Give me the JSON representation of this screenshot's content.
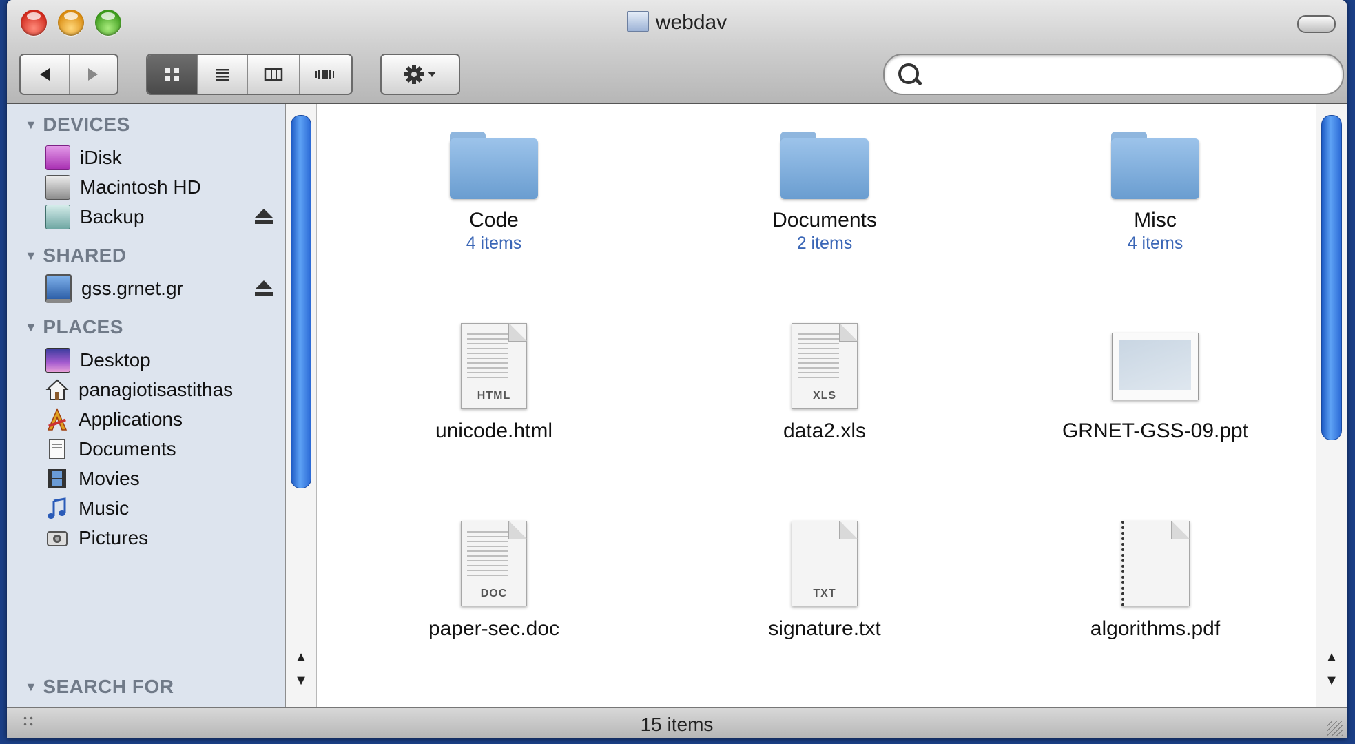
{
  "window": {
    "title": "webdav"
  },
  "toolbar": {
    "back_icon": "back-arrow-icon",
    "forward_icon": "forward-arrow-icon",
    "view_modes": [
      "icon-view",
      "list-view",
      "column-view",
      "coverflow-view"
    ],
    "action_icon": "gear-icon",
    "search_placeholder": ""
  },
  "sidebar": {
    "sections": [
      {
        "header": "DEVICES",
        "items": [
          {
            "label": "iDisk",
            "icon": "idisk-icon"
          },
          {
            "label": "Macintosh HD",
            "icon": "hard-drive-icon"
          },
          {
            "label": "Backup",
            "icon": "backup-drive-icon",
            "eject": true
          }
        ]
      },
      {
        "header": "SHARED",
        "items": [
          {
            "label": "gss.grnet.gr",
            "icon": "network-computer-icon",
            "eject": true
          }
        ]
      },
      {
        "header": "PLACES",
        "items": [
          {
            "label": "Desktop",
            "icon": "desktop-icon"
          },
          {
            "label": "panagiotisastithas",
            "icon": "home-icon"
          },
          {
            "label": "Applications",
            "icon": "applications-icon"
          },
          {
            "label": "Documents",
            "icon": "documents-icon"
          },
          {
            "label": "Movies",
            "icon": "movies-icon"
          },
          {
            "label": "Music",
            "icon": "music-icon"
          },
          {
            "label": "Pictures",
            "icon": "pictures-icon"
          }
        ]
      },
      {
        "header": "SEARCH FOR",
        "items": []
      }
    ]
  },
  "files": [
    {
      "name": "Code",
      "sub": "4 items",
      "kind": "folder"
    },
    {
      "name": "Documents",
      "sub": "2 items",
      "kind": "folder"
    },
    {
      "name": "Misc",
      "sub": "4 items",
      "kind": "folder"
    },
    {
      "name": "unicode.html",
      "kind": "doc",
      "badge": "HTML"
    },
    {
      "name": "data2.xls",
      "kind": "doc",
      "badge": "XLS"
    },
    {
      "name": "GRNET-GSS-09.ppt",
      "kind": "slide"
    },
    {
      "name": "paper-sec.doc",
      "kind": "doc",
      "badge": "DOC"
    },
    {
      "name": "signature.txt",
      "kind": "doc",
      "badge": "TXT"
    },
    {
      "name": "algorithms.pdf",
      "kind": "doc",
      "badge": ""
    }
  ],
  "status": {
    "text": "15 items"
  },
  "colors": {
    "desktop": "#1b3f86",
    "sidebar": "#dde4ee",
    "link_blue": "#3a66b6",
    "scroll_thumb": "#3b7be0"
  }
}
